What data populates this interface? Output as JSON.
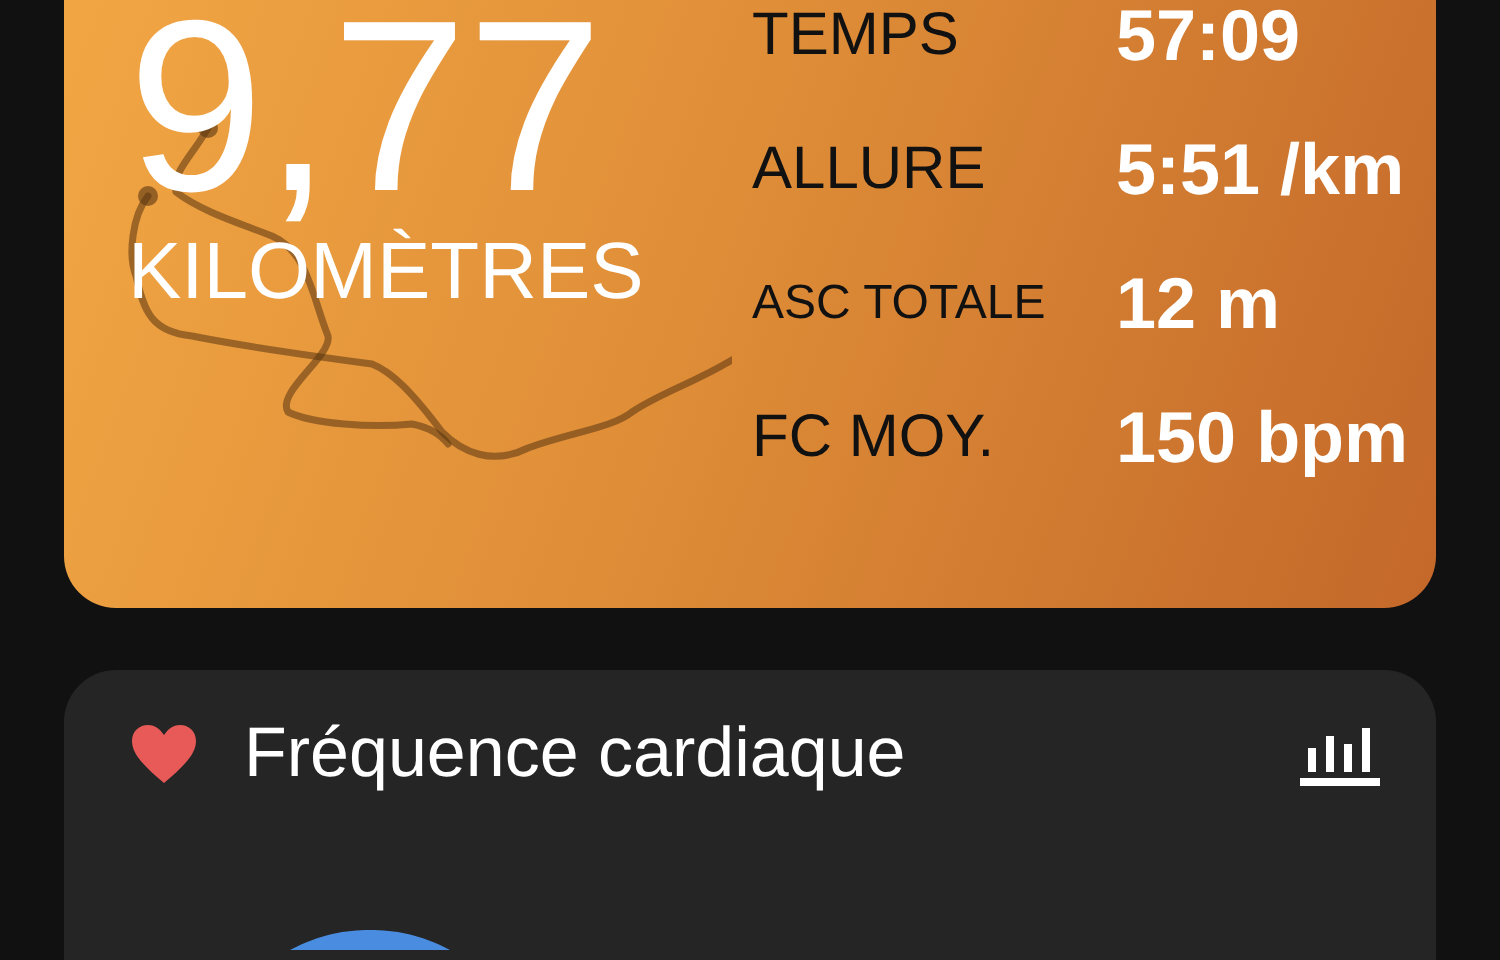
{
  "summary": {
    "distance": "9,77",
    "unit": "KILOMÈTRES",
    "stats": [
      {
        "label": "TEMPS",
        "value": "57:09",
        "kind": "normal"
      },
      {
        "label": "ALLURE",
        "value": "5:51 /km",
        "kind": "normal"
      },
      {
        "label": "ASC TOTALE",
        "value": "12 m",
        "kind": "small"
      },
      {
        "label": "FC MOY.",
        "value": "150 bpm",
        "kind": "normal"
      }
    ]
  },
  "heart_rate": {
    "title": "Fréquence cardiaque"
  }
}
